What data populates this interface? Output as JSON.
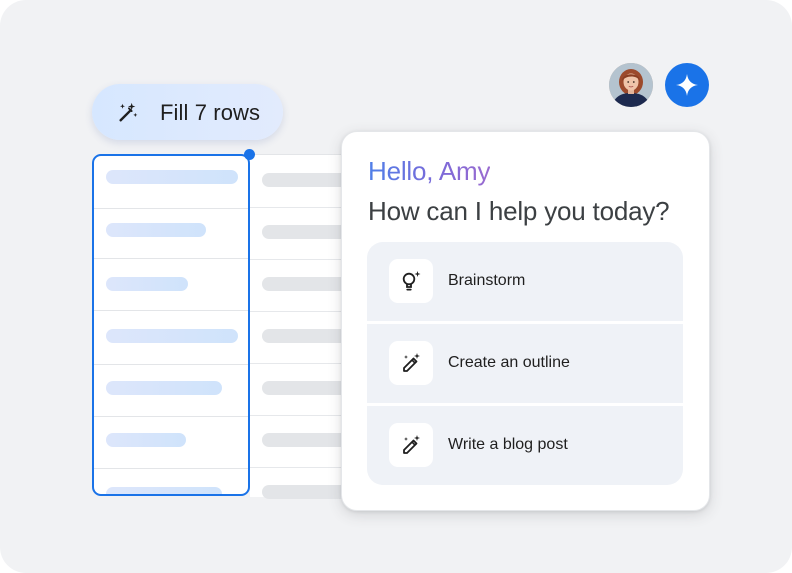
{
  "fill_chip": {
    "label": "Fill 7 rows",
    "icon": "magic-wand-icon"
  },
  "spreadsheet": {
    "accent": "#1a73e8",
    "rows": 7
  },
  "header": {
    "user_avatar": "user-avatar",
    "assistant_icon": "sparkle-icon",
    "assistant_color": "#1a73e8"
  },
  "chat": {
    "greeting": "Hello, Amy",
    "question": "How can I help you today?",
    "options": [
      {
        "label": "Brainstorm",
        "icon": "lightbulb-sparkle-icon"
      },
      {
        "label": "Create an outline",
        "icon": "magic-pen-icon"
      },
      {
        "label": "Write a blog post",
        "icon": "magic-pen-icon"
      }
    ]
  }
}
